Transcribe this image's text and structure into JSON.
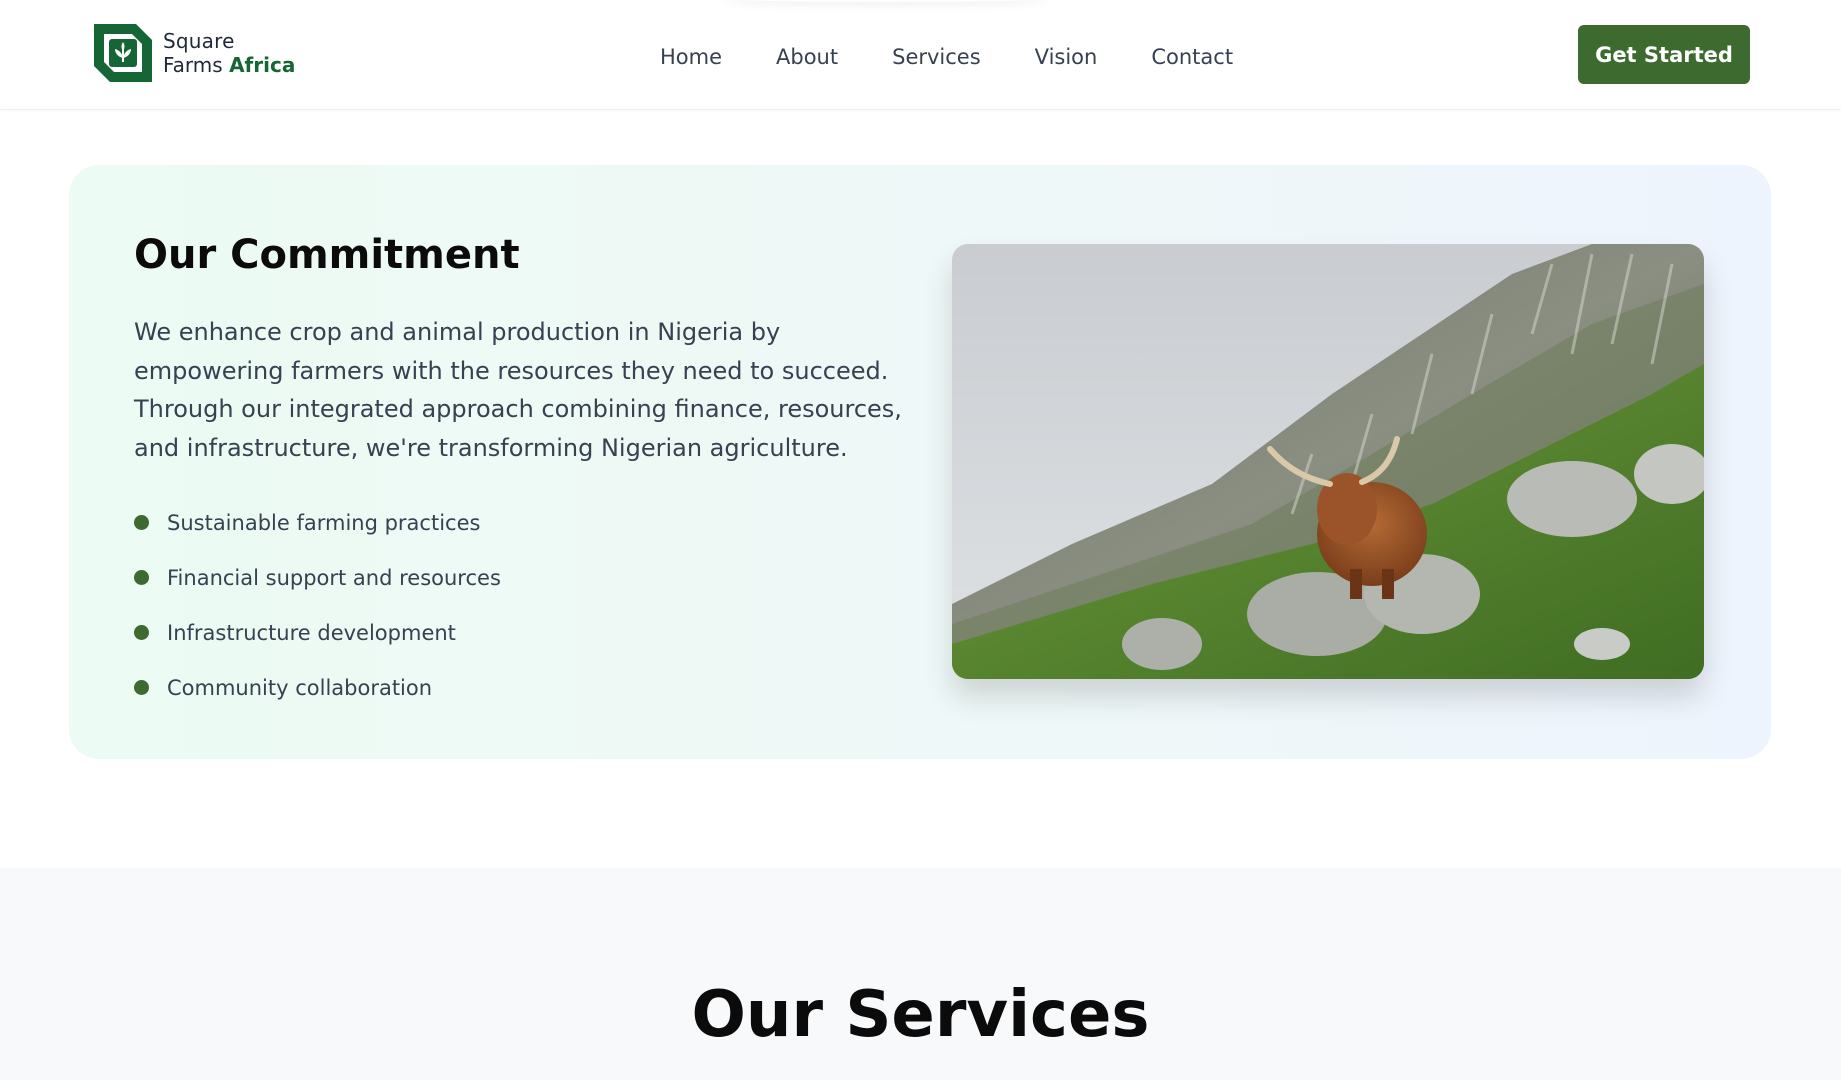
{
  "brand": {
    "line1": "Square",
    "line2_prefix": "Farms ",
    "line2_accent": "Africa"
  },
  "nav": [
    {
      "label": "Home"
    },
    {
      "label": "About"
    },
    {
      "label": "Services"
    },
    {
      "label": "Vision"
    },
    {
      "label": "Contact"
    }
  ],
  "cta": {
    "label": "Get Started"
  },
  "commitment": {
    "title": "Our Commitment",
    "description": "We enhance crop and animal production in Nigeria by empowering farmers with the resources they need to succeed. Through our integrated approach combining finance, resources, and infrastructure, we're transforming Nigerian agriculture.",
    "features": [
      {
        "label": "Sustainable farming practices"
      },
      {
        "label": "Financial support and resources"
      },
      {
        "label": "Infrastructure development"
      },
      {
        "label": "Community collaboration"
      }
    ],
    "image_icon": "highland-cow-photo"
  },
  "services": {
    "title": "Our Services"
  },
  "colors": {
    "brand_green": "#3d6b2f",
    "logo_green": "#166534"
  }
}
